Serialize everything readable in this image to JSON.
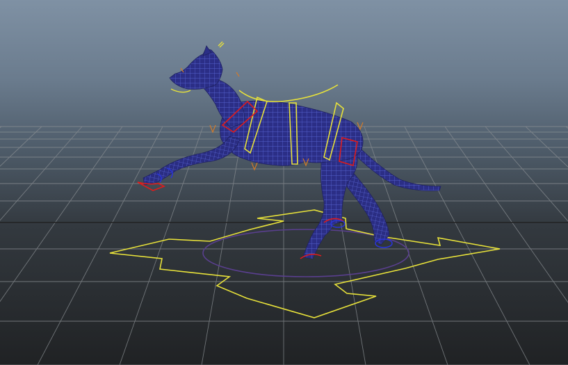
{
  "viewport": {
    "name": "3d-perspective-viewport",
    "background_top": "#7f91a4",
    "background_bottom": "#202224"
  },
  "scene": {
    "subject": "dog-rig-wireframe",
    "mesh_color": "#2b2e86",
    "wire_color": "#4b57c9",
    "control_color": "#e8e23a",
    "ik_color": "#e01b1b",
    "fk_color": "#2a34d8",
    "orient_color": "#d27a2a",
    "grid_color": "#8a8f93",
    "ground_circle_color": "#5a3f8f"
  },
  "controls": {
    "main_move": "four-arrow-move-control",
    "ground_circle": "root-circle-control",
    "spine": "spine-box-controls",
    "shoulder": "shoulder-arc-control"
  }
}
